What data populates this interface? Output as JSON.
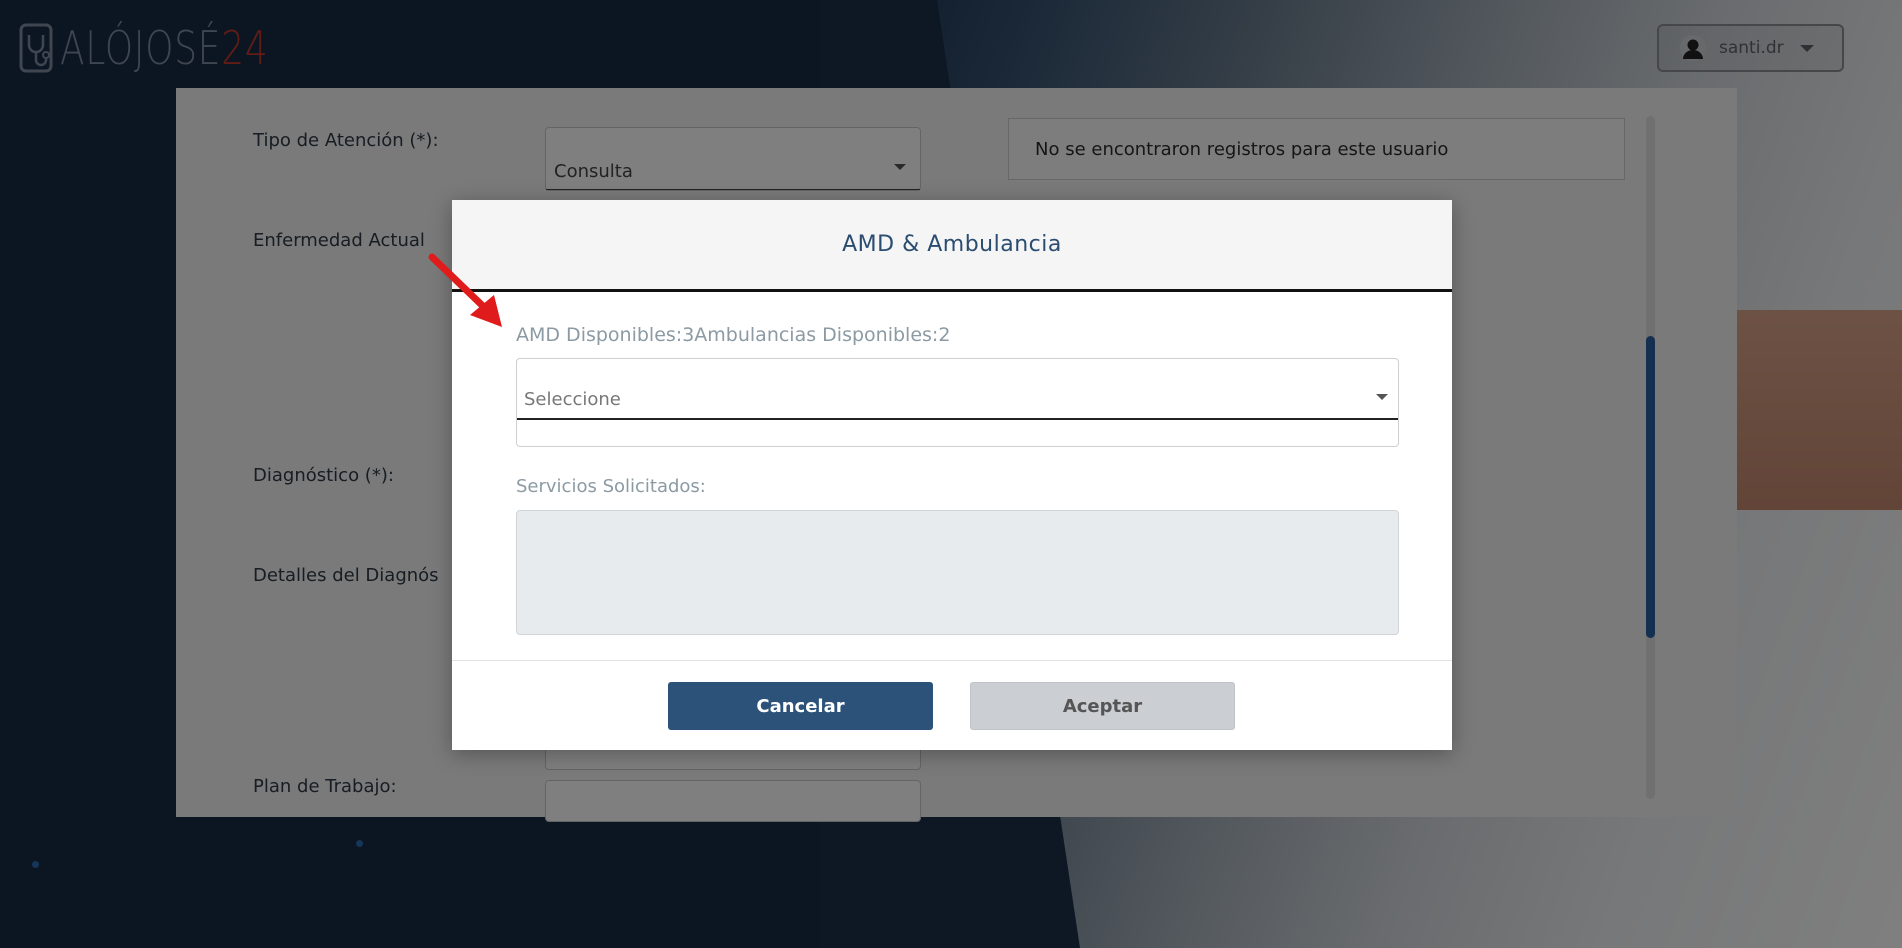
{
  "header": {
    "logo_text_main": "ALÓJOSÉ",
    "logo_text_accent": "24",
    "user_name": "santi.dr",
    "icons": [
      "stethoscope-logo-icon",
      "user-avatar-icon",
      "caret-down-icon"
    ]
  },
  "form": {
    "tipo_atencion_label": "Tipo de Atención (*):",
    "tipo_atencion_value": "Consulta",
    "enfermedad_actual_label": "Enfermedad Actual",
    "diagnostico_label": "Diagnóstico (*):",
    "detalles_diagnostico_label": "Detalles del Diagnós",
    "plan_trabajo_label": "Plan de Trabajo:",
    "no_records_text": "No se encontraron registros para este usuario"
  },
  "modal": {
    "title": "AMD & Ambulancia",
    "availability_text": "AMD Disponibles:3Ambulancias Disponibles:2",
    "select_placeholder": "Seleccione",
    "services_label": "Servicios Solicitados:",
    "services_value": "",
    "cancel_label": "Cancelar",
    "accept_label": "Aceptar"
  },
  "colors": {
    "primary": "#2c527a",
    "title": "#2a4c70",
    "logo_accent": "#c0392b",
    "arrow": "#e01b1b",
    "background": "#182c46"
  }
}
